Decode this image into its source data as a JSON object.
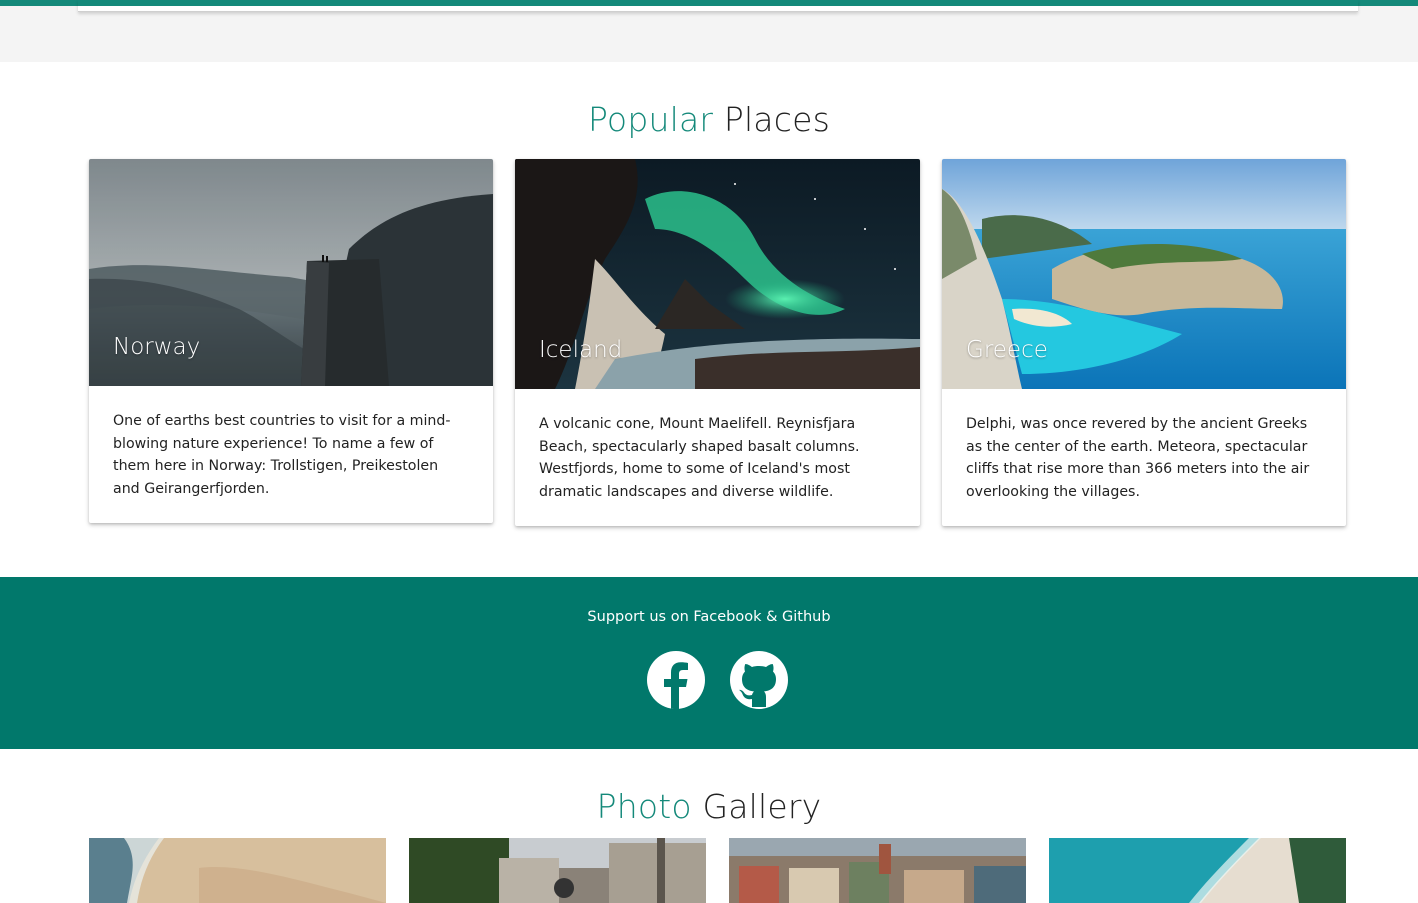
{
  "popular": {
    "title_accent": "Popular",
    "title_rest": "Places",
    "cards": [
      {
        "title": "Norway",
        "image": "norway-cliff-fjord-photo",
        "text": "One of earths best countries to visit for a mind-blowing nature experience! To name a few of them here in Norway: Trollstigen, Preikestolen and Geirangerfjorden."
      },
      {
        "title": "Iceland",
        "image": "iceland-aurora-volcano-photo",
        "text": "A volcanic cone, Mount Maelifell. Reynisfjara Beach, spectacularly shaped basalt columns. Westfjords, home to some of Iceland's most dramatic landscapes and diverse wildlife."
      },
      {
        "title": "Greece",
        "image": "greece-navagio-beach-photo",
        "text": "Delphi, was once revered by the ancient Greeks as the center of the earth. Meteora, spectacular cliffs that rise more than 366 meters into the air overlooking the villages."
      }
    ]
  },
  "footer": {
    "text": "Support us on Facebook & Github",
    "icons": [
      "facebook-icon",
      "github-icon"
    ]
  },
  "gallery": {
    "title_accent": "Photo",
    "title_rest": "Gallery",
    "items": [
      "beach-aerial-photo",
      "paris-street-photo",
      "city-rooftops-photo",
      "coast-aerial-photo"
    ]
  },
  "colors": {
    "accent": "#14897a",
    "footer_bg": "#01786b"
  }
}
